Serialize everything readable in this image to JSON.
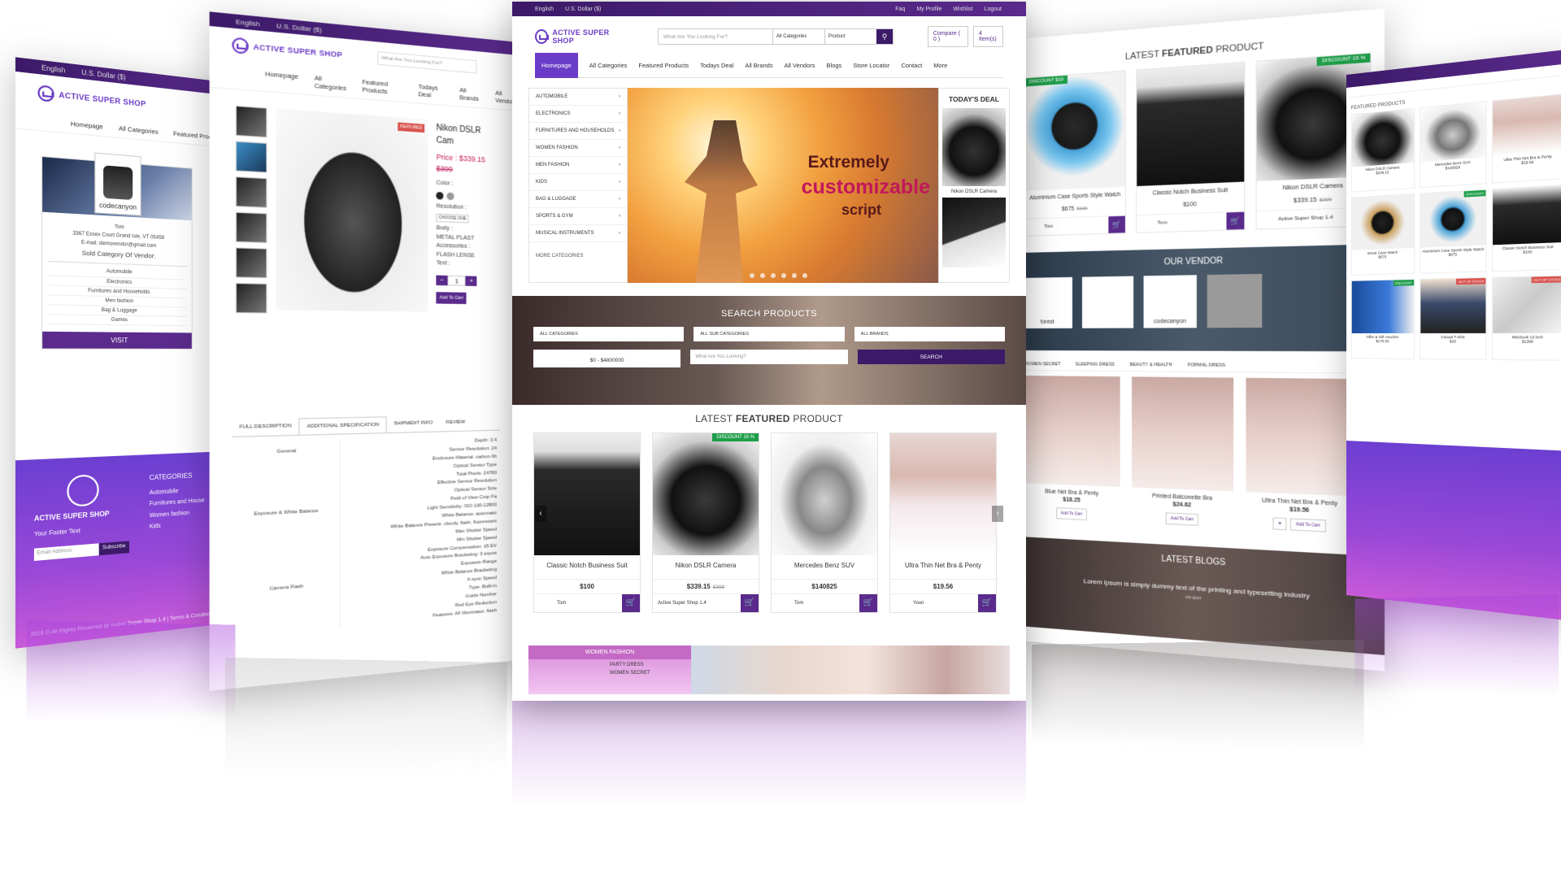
{
  "center": {
    "topbar": {
      "language": "English",
      "currency": "U.S. Dollar ($)",
      "links": [
        "Faq",
        "My Profile",
        "Wishlist",
        "Logout"
      ]
    },
    "logo": {
      "name": "ACTIVE SUPER SHOP"
    },
    "search": {
      "placeholder": "What Are You Looking For?",
      "category": "All Categories",
      "type": "Product"
    },
    "header_buttons": {
      "compare": "Compare ( 0 )",
      "cart": "4 Item(s)"
    },
    "nav": [
      "Homepage",
      "All Categories",
      "Featured Products",
      "Todays Deal",
      "All Brands",
      "All Vendors",
      "Blogs",
      "Store Locator",
      "Contact",
      "More"
    ],
    "category_menu": [
      "AUTOMOBILE",
      "ELECTRONICS",
      "FURNITURES AND HOUSEHOLDS",
      "WOMEN FASHION",
      "MEN FASHION",
      "KIDS",
      "BAG & LUGGAGE",
      "SPORTS & GYM",
      "MUSICAL INSTRUMENTS"
    ],
    "more_categories": "MORE CATEGORIES",
    "slider": {
      "line1": "Extremely",
      "line2": "customizable",
      "line3": "script"
    },
    "todays_deal": {
      "title": "TODAY'S DEAL",
      "item": "Nikon DSLR Camera"
    },
    "search_products": {
      "title": "SEARCH PRODUCTS",
      "all_categories": "ALL CATEGORIES",
      "all_sub_categories": "ALL SUB CATEGORIES",
      "all_brands": "ALL BRANDS",
      "price_range": "$0 - $4800000",
      "keyword_placeholder": "What Are You Looking?",
      "button": "SEARCH"
    },
    "featured": {
      "title_light": "LATEST",
      "title_bold": "FEATURED",
      "title_end": "PRODUCT",
      "products": [
        {
          "name": "Classic Notch Business Suit",
          "price": "$100",
          "old_price": "",
          "seller": "Tom",
          "discount": ""
        },
        {
          "name": "Nikon DSLR Camera",
          "price": "$339.15",
          "old_price": "$399",
          "seller": "Active Super Shop 1.4",
          "discount": "DISCOUNT 15 %"
        },
        {
          "name": "Mercedes Benz SUV",
          "price": "$140825",
          "old_price": "",
          "seller": "Tom",
          "discount": ""
        },
        {
          "name": "Ultra Thin Net Bra & Penty",
          "price": "$19.56",
          "old_price": "",
          "seller": "Youn",
          "discount": ""
        }
      ]
    },
    "women_fashion": {
      "title": "WOMEN FASHION",
      "links": [
        "PARTY DRESS",
        "WOMEN SECRET"
      ]
    }
  },
  "left_vendor": {
    "topbar": {
      "language": "English",
      "currency": "U.S. Dollar ($)"
    },
    "logo": "ACTIVE SUPER SHOP",
    "nav": [
      "Homepage",
      "All Categories",
      "Featured Products"
    ],
    "vendor": {
      "badge": "codecanyon",
      "name": "Tom",
      "address": "3367 Essex Court Grand Isle, VT 05458",
      "email": "E-mail: demovendor@gmail.com",
      "sold_title": "Sold Category Of Vendor:",
      "sold": [
        "Automobile",
        "Electronics",
        "Furnitures and Households",
        "Men fashion",
        "Bag & Luggage",
        "Games"
      ],
      "visit": "VISIT"
    },
    "footer": {
      "brand": "ACTIVE SUPER SHOP",
      "text": "Your Footer Text",
      "email_placeholder": "Email Address",
      "subscribe": "Subscribe",
      "categories_title": "CATEGORIES",
      "categories": [
        "Automobile",
        "Furnitures and House",
        "Women fashion",
        "Kids"
      ],
      "copyright": "2016 © All Rights Reserved @ Active Super Shop 1.4 | Terms & Condition"
    }
  },
  "left_product": {
    "topbar": {
      "language": "English",
      "currency": "U.S. Dollar ($)"
    },
    "logo": "ACTIVE SUPER SHOP",
    "search_placeholder": "What Are You Looking For?",
    "nav": [
      "Homepage",
      "All Categories",
      "Featured Products",
      "Todays Deal",
      "All Brands",
      "All Vendors"
    ],
    "product": {
      "name": "Nikon DSLR Cam",
      "tag": "FEATURED",
      "price_label": "Price :",
      "price": "$339.15",
      "old_price": "$399",
      "color_label": "Color :",
      "resolution_label": "Resolution :",
      "resolution_value": "CHOOSE ONE",
      "body_label": "Body :",
      "body_options": [
        "METAL",
        "PLAST"
      ],
      "accessories_label": "Accessories :",
      "accessories": [
        "FLASH",
        "LENSE"
      ],
      "text_label": "Text :",
      "qty": "1",
      "add_to_cart": "Add To Cart"
    },
    "tabs": [
      "FULL DESCRIPTION",
      "ADDITIONAL SPECIFICATION",
      "SHIPMENT INFO",
      "REVIEW"
    ],
    "spec_keys": [
      "General",
      "Exposure & White Balance",
      "Camera Flash"
    ],
    "spec_lines": [
      "Depth: 3.4",
      "Sensor Resolution: 24",
      "Enclosure Material: carbon fib",
      "Optical Sensor Type",
      "Total Pixels: 24780",
      "Effective Sensor Resolution",
      "Optical Sensor Size",
      "Field of View Crop Fa",
      "Light Sensitivity: ISO 100-12800",
      "White Balance: automatic",
      "White Balance Presets: cloudy, flash, fluorescent",
      "Max Shutter Speed",
      "Min Shutter Speed",
      "Exposure Compensation: ±5 EV",
      "Auto Exposure Bracketing: 3 expos",
      "Exposure Range",
      "White Balance Bracketing",
      "X-sync Speed",
      "Type: Built-in",
      "Guide Number",
      "Red Eye Reduction",
      "Features: AF illuminator, flash"
    ]
  },
  "right_home": {
    "featured_title": {
      "light": "LATEST",
      "bold": "FEATURED",
      "end": "PRODUCT"
    },
    "products": [
      {
        "name": "Aluminium Case Sports Style Watch",
        "price": "$675",
        "old_price": "$686",
        "seller": "Tom",
        "discount": "DISCOUNT $10"
      },
      {
        "name": "Classic Notch Business Suit",
        "price": "$100",
        "old_price": "",
        "seller": "Tom",
        "discount": ""
      },
      {
        "name": "Nikon DSLR Camera",
        "price": "$339.15",
        "old_price": "$399",
        "seller": "Active Super Shop 1.4",
        "discount": "DISCOUNT 15 %"
      }
    ],
    "vendor_title": "OUR VENDOR",
    "vendors": [
      "forest",
      "",
      "codecanyon",
      ""
    ],
    "women_tabs": [
      "WOMEN SECRET",
      "SLEEPING DRESS",
      "BEAUTY & HEALTH",
      "FORMAL DRESS"
    ],
    "women_products": [
      {
        "name": "Blue Net Bra & Penty",
        "price": "$18.25"
      },
      {
        "name": "Printed Balconette Bra",
        "price": "$24.62"
      },
      {
        "name": "Ultra Thin Net Bra & Penty",
        "price": "$19.56"
      }
    ],
    "add_to_cart": "Add To Cart",
    "blogs_title": "LATEST BLOGS",
    "blog_text": "Lorem Ipsum is simply dummy text of the printing and typesetting industry",
    "blog_author": "mr.tom"
  },
  "far_right": {
    "grid_title": "FEATURED PRODUCTS",
    "items": [
      {
        "name": "Nikon DSLR Camera",
        "price": "$339.15",
        "tag": ""
      },
      {
        "name": "Mercedes Benz SUV",
        "price": "$140825",
        "tag": ""
      },
      {
        "name": "Ultra Thin Net Bra & Penty",
        "price": "$19.56",
        "tag": ""
      },
      {
        "name": "Smart Case Watch",
        "price": "$675",
        "tag": ""
      },
      {
        "name": "Aluminium Case Sports Style Watch",
        "price": "$675",
        "tag": "DISCOUNT"
      },
      {
        "name": "Classic Notch Business Suit",
        "price": "$100",
        "tag": ""
      },
      {
        "name": "Offer & Gift Voucher",
        "price": "$175.50",
        "tag": "DISCOUNT"
      },
      {
        "name": "Casual T-shirt",
        "price": "$29",
        "tag": "OUT OF STOCK"
      },
      {
        "name": "Macbook 13 inch",
        "price": "$1399",
        "tag": "OUT OF STOCK"
      }
    ]
  }
}
